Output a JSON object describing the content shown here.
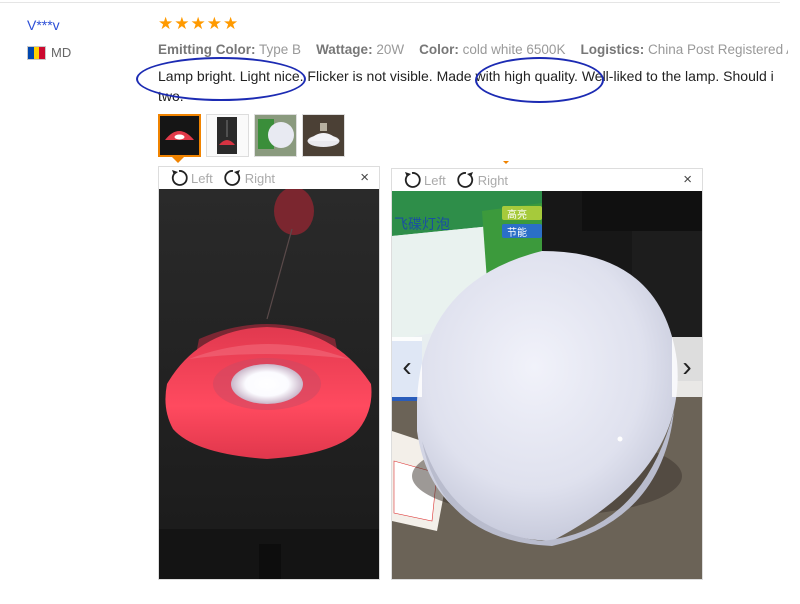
{
  "reviewer": {
    "name": "V***v",
    "country": "MD"
  },
  "rating": {
    "stars": 5,
    "star_glyph": "★",
    "color": "#ff9a00"
  },
  "attributes": [
    {
      "label": "Emitting Color:",
      "value": "Type B"
    },
    {
      "label": "Wattage:",
      "value": "20W"
    },
    {
      "label": "Color:",
      "value": "cold white 6500K"
    },
    {
      "label": "Logistics:",
      "value": "China Post Registered A"
    }
  ],
  "review_text": "Lamp bright. Light nice. Flicker is not visible. Made with high quality. Well-liked to the lamp. Should i two.",
  "thumbnails": [
    "red-pendant-lamp-photo",
    "lamp-hanging-photo",
    "lamp-box-photo",
    "lamp-bulb-photo"
  ],
  "viewer_left": {
    "rotate_left": "Left",
    "rotate_right": "Right",
    "close": "×"
  },
  "viewer_right": {
    "rotate_left": "Left",
    "rotate_right": "Right",
    "close": "×",
    "prev": "‹",
    "next": "›"
  },
  "box_text": {
    "line1": "飞碟灯泡",
    "badge1": "高亮",
    "badge2": "节能"
  },
  "accent_color": "#f08300",
  "annotation_color": "#1c2bb3"
}
